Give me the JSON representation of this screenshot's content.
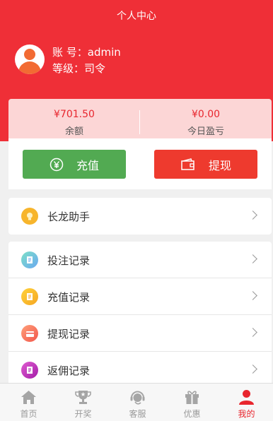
{
  "header": {
    "title": "个人中心"
  },
  "user": {
    "account_line": "账 号：admin",
    "level_line": "等级：司令"
  },
  "balance": {
    "balance_amount": "¥701.50",
    "balance_label": "余额",
    "today_amount": "¥0.00",
    "today_label": "今日盈亏"
  },
  "actions": {
    "recharge_label": "充值",
    "withdraw_label": "提现"
  },
  "menu_primary": [
    {
      "label": "长龙助手",
      "icon": "lightbulb-icon"
    }
  ],
  "menu_records": [
    {
      "label": "投注记录",
      "icon": "bet-record-icon"
    },
    {
      "label": "充值记录",
      "icon": "recharge-record-icon"
    },
    {
      "label": "提现记录",
      "icon": "withdraw-record-icon"
    },
    {
      "label": "返佣记录",
      "icon": "commission-record-icon"
    }
  ],
  "tabbar": [
    {
      "label": "首页",
      "icon": "home-icon"
    },
    {
      "label": "开奖",
      "icon": "trophy-icon"
    },
    {
      "label": "客服",
      "icon": "support-icon"
    },
    {
      "label": "优惠",
      "icon": "gift-icon"
    },
    {
      "label": "我的",
      "icon": "user-icon",
      "active": true
    }
  ],
  "colors": {
    "brand_red": "#ef2f37",
    "recharge_green": "#52aa52",
    "withdraw_red": "#ee3a2e",
    "balance_bg": "#fcd6d6"
  }
}
